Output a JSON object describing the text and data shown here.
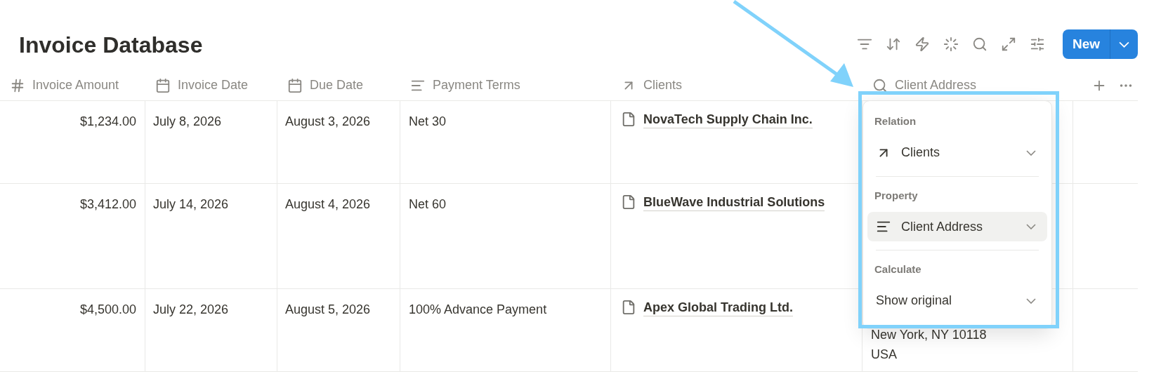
{
  "title": "Invoice Database",
  "new_button": "New",
  "columns": [
    {
      "kind": "number",
      "label": "Invoice Amount"
    },
    {
      "kind": "date",
      "label": "Invoice Date"
    },
    {
      "kind": "date",
      "label": "Due Date"
    },
    {
      "kind": "text",
      "label": "Payment Terms"
    },
    {
      "kind": "relation",
      "label": "Clients"
    },
    {
      "kind": "rollup",
      "label": "Client Address"
    }
  ],
  "rows": [
    {
      "amount": "$1,234.00",
      "invoice_date": "July 8, 2026",
      "due_date": "August 3, 2026",
      "terms": "Net 30",
      "client": "NovaTech Supply Chain Inc."
    },
    {
      "amount": "$3,412.00",
      "invoice_date": "July 14, 2026",
      "due_date": "August 4, 2026",
      "terms": "Net 60",
      "client": "BlueWave Industrial Solutions"
    },
    {
      "amount": "$4,500.00",
      "invoice_date": "July 22, 2026",
      "due_date": "August 5, 2026",
      "terms": "100% Advance Payment",
      "client": "Apex Global Trading Ltd.",
      "address": [
        "New York, NY 10118",
        "USA"
      ]
    }
  ],
  "popup": {
    "sections": [
      {
        "heading": "Relation",
        "value": "Clients",
        "kind": "relation",
        "highlighted": false
      },
      {
        "heading": "Property",
        "value": "Client Address",
        "kind": "text",
        "highlighted": true
      },
      {
        "heading": "Calculate",
        "value": "Show original",
        "kind": "plain",
        "highlighted": false
      }
    ]
  }
}
